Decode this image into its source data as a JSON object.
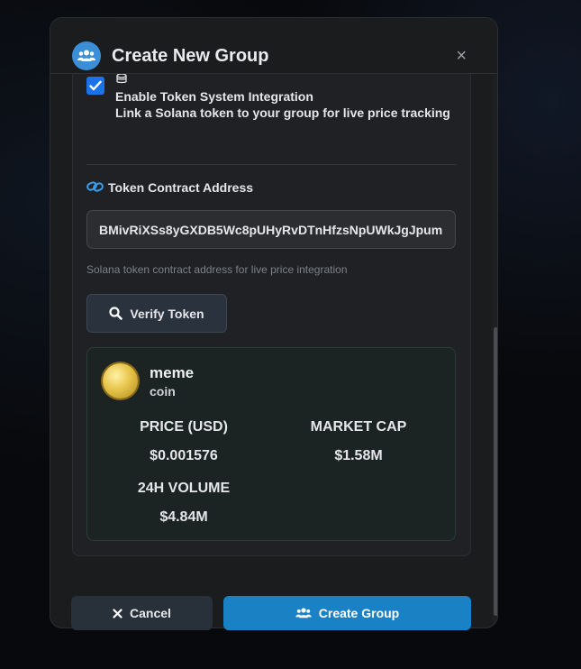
{
  "modal": {
    "title": "Create New Group",
    "close_label": "×"
  },
  "token_integration": {
    "checked": true,
    "title": "Enable Token System Integration",
    "description": "Link a Solana token to your group for live price tracking"
  },
  "contract_field": {
    "label": "Token Contract Address",
    "value": "BMivRiXSs8yGXDB5Wc8pUHyRvDTnHfzsNpUWkJgJpump",
    "helper": "Solana token contract address for live price integration"
  },
  "verify_button": {
    "label": "Verify Token"
  },
  "token": {
    "name": "meme",
    "symbol": "coin",
    "price_label": "PRICE (USD)",
    "price_value": "$0.001576",
    "market_cap_label": "MARKET CAP",
    "market_cap_value": "$1.58M",
    "volume_label": "24H VOLUME",
    "volume_value": "$4.84M"
  },
  "footer": {
    "cancel_label": "Cancel",
    "create_label": "Create Group"
  },
  "icons": {
    "header": "users-icon",
    "close": "close-icon",
    "checkbox": "checkmark-icon",
    "coins": "coins-icon",
    "link": "link-icon",
    "verify": "search-icon",
    "token_logo": "coin-logo-icon",
    "cancel": "x-icon",
    "create": "users-icon"
  },
  "colors": {
    "accent": "#1a82c4",
    "checkbox": "#1a73e8",
    "header_icon_bg": "#3b8fd6",
    "token_card_bg": "#1b2422"
  }
}
